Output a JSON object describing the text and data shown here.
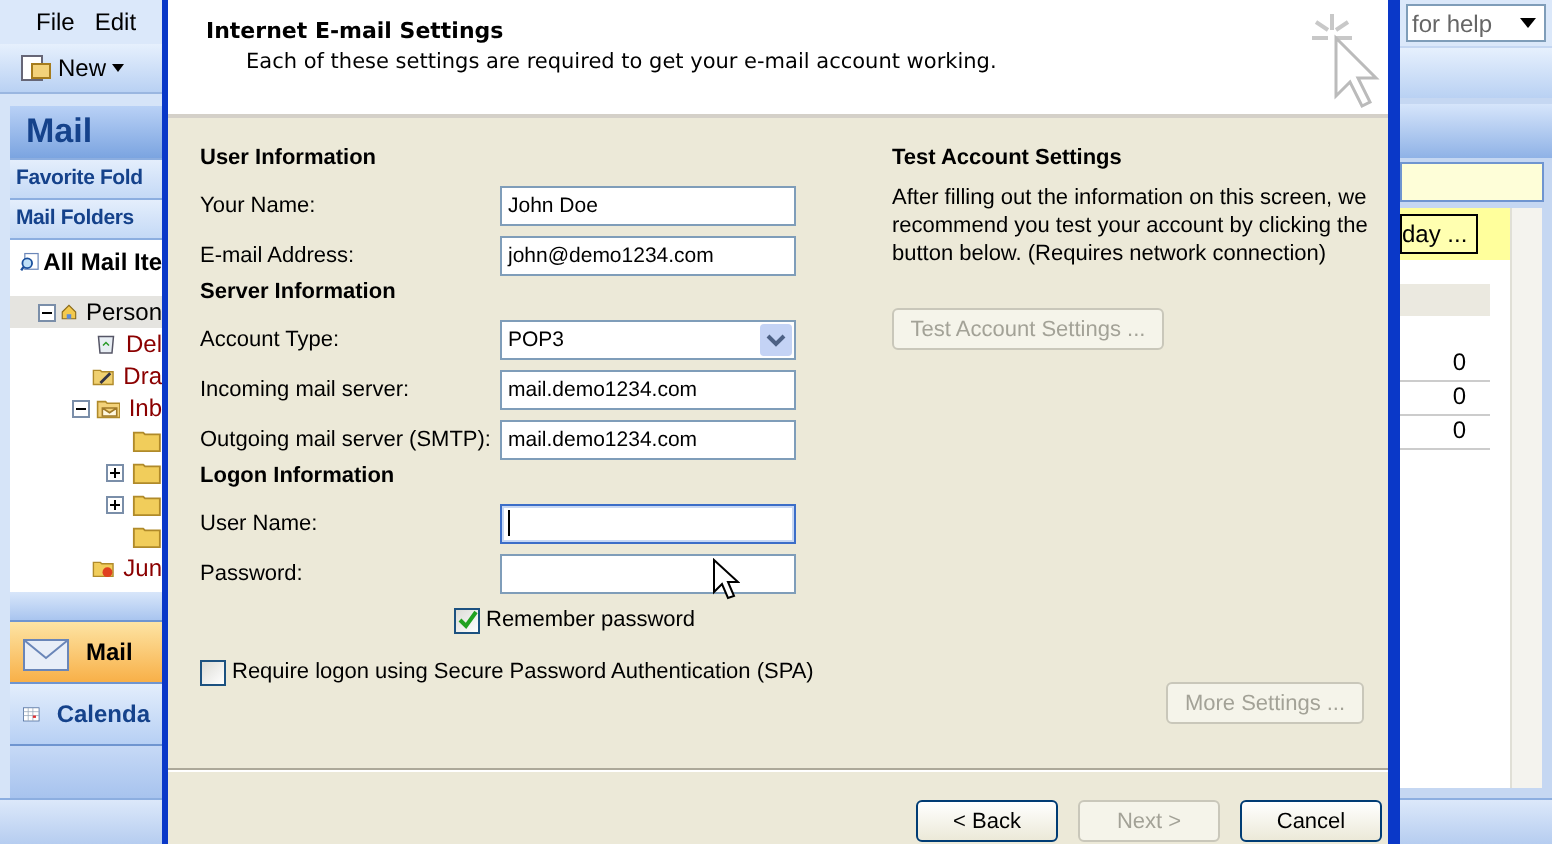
{
  "background_window": {
    "menu": [
      "File",
      "Edit"
    ],
    "toolbar": {
      "new_button": "New"
    },
    "help_search": {
      "placeholder": "for help"
    },
    "navigation_pane": {
      "title": "Mail",
      "sections": [
        "Favorite Fold",
        "Mail Folders"
      ],
      "all_mail_items": "All Mail Ite",
      "folders": [
        {
          "name": "Person",
          "kind": "personal",
          "expanded": true,
          "selected": true,
          "children": [
            {
              "name": "Del",
              "kind": "deleted",
              "selected": false
            },
            {
              "name": "Dra",
              "kind": "drafts",
              "selected": false
            },
            {
              "name": "Inb",
              "kind": "inbox",
              "expanded": true,
              "selected": false,
              "children": [
                {
                  "kind": "folder",
                  "selected": false
                },
                {
                  "kind": "folder",
                  "expanded": false,
                  "selected": false
                },
                {
                  "kind": "folder",
                  "expanded": false,
                  "selected": false
                },
                {
                  "kind": "folder",
                  "selected": false
                }
              ]
            },
            {
              "name": "Jun",
              "kind": "junk",
              "selected": false
            }
          ]
        }
      ],
      "nav_buttons": [
        {
          "label": "Mail",
          "kind": "mail",
          "selected": true
        },
        {
          "label": "Calenda",
          "kind": "calendar",
          "selected": false
        }
      ]
    },
    "reading_pane": {
      "button": "day ...",
      "counts": [
        "0",
        "0",
        "0"
      ]
    }
  },
  "dialog": {
    "title": "Internet E-mail Settings",
    "subtitle": "Each of these settings are required to get your e-mail account working.",
    "sections": [
      {
        "heading": "User Information",
        "fields": [
          {
            "label": "Your Name:",
            "kind": "text",
            "value": "John Doe"
          },
          {
            "label": "E-mail Address:",
            "kind": "text",
            "value": "john@demo1234.com"
          }
        ]
      },
      {
        "heading": "Server Information",
        "fields": [
          {
            "label": "Account Type:",
            "kind": "select",
            "value": "POP3"
          },
          {
            "label": "Incoming mail server:",
            "kind": "text",
            "value": "mail.demo1234.com"
          },
          {
            "label": "Outgoing mail server (SMTP):",
            "kind": "text",
            "value": "mail.demo1234.com"
          }
        ]
      },
      {
        "heading": "Logon Information",
        "fields": [
          {
            "label": "User Name:",
            "kind": "text",
            "focused": true
          },
          {
            "label": "Password:",
            "kind": "text",
            "focused": false
          }
        ]
      }
    ],
    "remember_password": {
      "label": "Remember password",
      "checked": true
    },
    "spa": {
      "label": "Require logon using Secure Password Authentication (SPA)",
      "checked": false
    },
    "test_account": {
      "heading": "Test Account Settings",
      "description": "After filling out the information on this screen, we recommend you test your account by clicking the button below. (Requires network connection)",
      "button": {
        "label": "Test Account Settings ...",
        "disabled": true
      }
    },
    "more_settings_button": {
      "label": "More Settings ...",
      "disabled": true
    },
    "buttons": [
      {
        "label": "< Back",
        "disabled": false
      },
      {
        "label": "Next >",
        "disabled": true
      },
      {
        "label": "Cancel",
        "disabled": false
      }
    ]
  }
}
